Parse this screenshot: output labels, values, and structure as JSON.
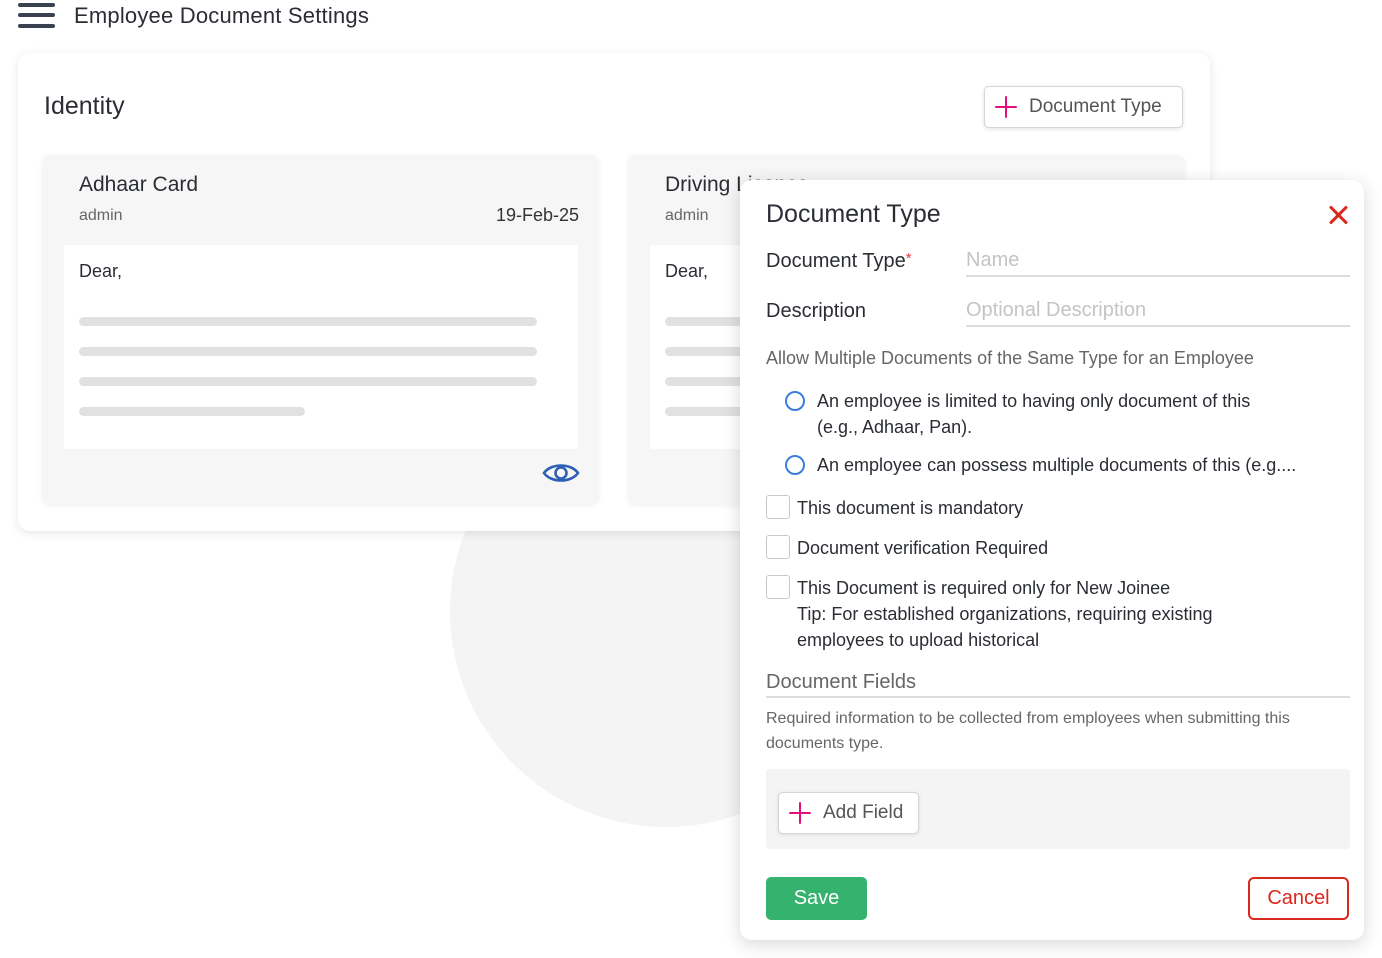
{
  "header": {
    "title": "Employee Document Settings",
    "menu_icon": "hamburger-menu-icon"
  },
  "identity": {
    "title": "Identity",
    "add_button_label": "Document Type",
    "cards": [
      {
        "title": "Adhaar Card",
        "owner": "admin",
        "date": "19-Feb-25",
        "greeting": "Dear,"
      },
      {
        "title": "Driving Licence",
        "owner": "admin",
        "greeting": "Dear,"
      }
    ]
  },
  "modal": {
    "title": "Document Type",
    "doc_type_label": "Document Type",
    "required_mark": "*",
    "doc_type_placeholder": "Name",
    "description_label": "Description",
    "description_placeholder": "Optional Description",
    "allow_multiple_title": "Allow Multiple Documents of the Same Type for an Employee",
    "radio_options": [
      {
        "line1": "An employee is limited to having only document of this",
        "line2": "(e.g., Adhaar, Pan)."
      },
      {
        "line1": "An employee can possess multiple documents of this (e.g...."
      }
    ],
    "checkboxes": [
      {
        "label": "This document is mandatory"
      },
      {
        "label": "Document verification Required"
      },
      {
        "label": "This Document is required only for New Joinee",
        "tip_line1": "Tip: For established organizations, requiring existing",
        "tip_line2": "employees to upload historical"
      }
    ],
    "fields_title": "Document Fields",
    "fields_description": "Required information to be collected from employees when submitting this documents type.",
    "add_field_label": "Add Field",
    "save_label": "Save",
    "cancel_label": "Cancel"
  },
  "colors": {
    "accent_plus": "#e3107a",
    "save_green": "#35b36e",
    "cancel_red": "#d9281d",
    "radio_blue": "#3b7ddd",
    "eye_blue": "#2f5fb5"
  }
}
